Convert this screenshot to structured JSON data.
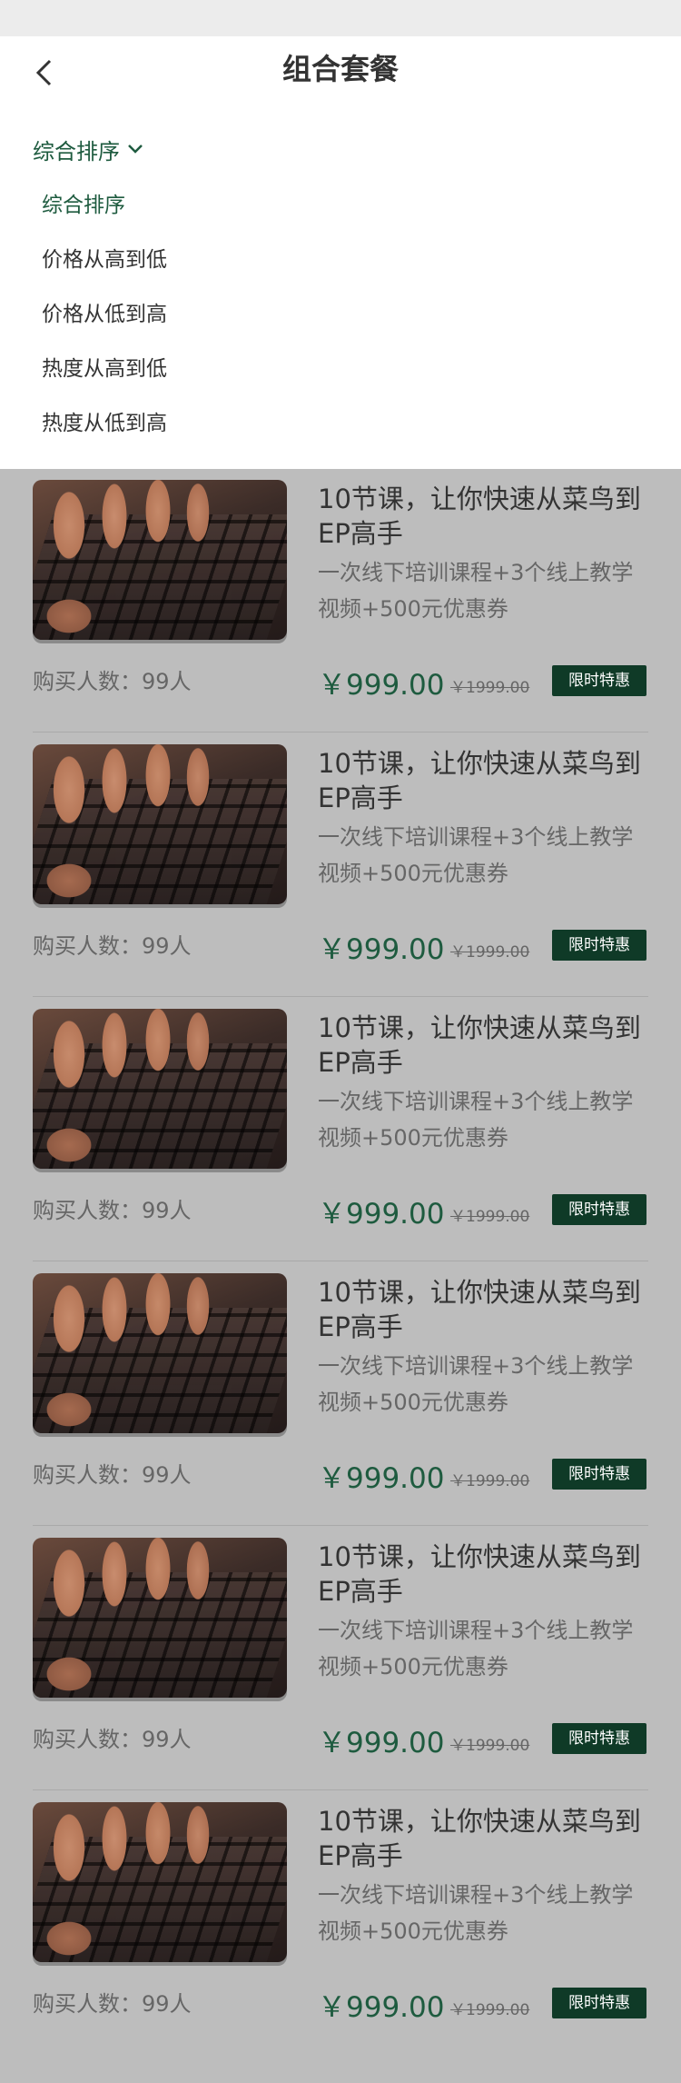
{
  "header": {
    "title": "组合套餐"
  },
  "sort": {
    "current": "综合排序",
    "options": [
      "综合排序",
      "价格从高到低",
      "价格从低到高",
      "热度从高到低",
      "热度从低到高"
    ]
  },
  "products": [
    {
      "title": "10节课，让你快速从菜鸟到EP高手",
      "desc": "一次线下培训课程+3个线上教学视频+500元优惠券",
      "buyers": "购买人数：99人",
      "price": "￥999.00",
      "original_price": "￥1999.00",
      "badge": "限时特惠"
    },
    {
      "title": "10节课，让你快速从菜鸟到EP高手",
      "desc": "一次线下培训课程+3个线上教学视频+500元优惠券",
      "buyers": "购买人数：99人",
      "price": "￥999.00",
      "original_price": "￥1999.00",
      "badge": "限时特惠"
    },
    {
      "title": "10节课，让你快速从菜鸟到EP高手",
      "desc": "一次线下培训课程+3个线上教学视频+500元优惠券",
      "buyers": "购买人数：99人",
      "price": "￥999.00",
      "original_price": "￥1999.00",
      "badge": "限时特惠"
    },
    {
      "title": "10节课，让你快速从菜鸟到EP高手",
      "desc": "一次线下培训课程+3个线上教学视频+500元优惠券",
      "buyers": "购买人数：99人",
      "price": "￥999.00",
      "original_price": "￥1999.00",
      "badge": "限时特惠"
    },
    {
      "title": "10节课，让你快速从菜鸟到EP高手",
      "desc": "一次线下培训课程+3个线上教学视频+500元优惠券",
      "buyers": "购买人数：99人",
      "price": "￥999.00",
      "original_price": "￥1999.00",
      "badge": "限时特惠"
    },
    {
      "title": "10节课，让你快速从菜鸟到EP高手",
      "desc": "一次线下培训课程+3个线上教学视频+500元优惠券",
      "buyers": "购买人数：99人",
      "price": "￥999.00",
      "original_price": "￥1999.00",
      "badge": "限时特惠"
    }
  ],
  "colors": {
    "accent": "#1e5b3f",
    "badge_bg": "#0f3a27",
    "overlay_bg": "#bdbdbd"
  },
  "icons": {
    "back": "chevron-left-icon",
    "sort": "chevron-down-icon"
  }
}
